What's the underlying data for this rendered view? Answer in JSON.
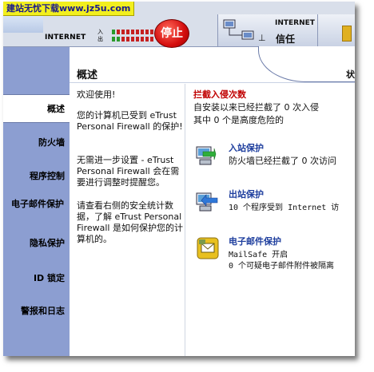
{
  "watermark": "建站无忧下载www.jz5u.com",
  "toolbar": {
    "internet_left": "INTERNET",
    "in_label": "入",
    "out_label": "出",
    "stop_label": "停止",
    "network_label": "INTERNET",
    "trust_label": "信任"
  },
  "sidebar": {
    "items": [
      {
        "label": "概述"
      },
      {
        "label": "防火墙"
      },
      {
        "label": "程序控制"
      },
      {
        "label": "电子邮件保护"
      },
      {
        "label": "隐私保护"
      },
      {
        "label": "ID 锁定"
      },
      {
        "label": "警报和日志"
      }
    ]
  },
  "content": {
    "title": "概述",
    "header_right": "状",
    "left": {
      "welcome": "欢迎使用!",
      "protected": "您的计算机已受到 eTrust Personal Firewall 的保护!",
      "setup": "无需进一步设置 - eTrust Personal Firewall 会在需要进行调整时提醒您。",
      "review": "请查看右侧的安全统计数据，了解 eTrust Personal Firewall 是如何保护您的计算机的。"
    },
    "intrusion": {
      "title": "拦截入侵次数",
      "line1": "自安装以来已经拦截了 0 次入侵",
      "line2": "其中 0 个是高度危险的"
    },
    "inbound": {
      "title": "入站保护",
      "line1": "防火墙已经拦截了 0 次访问"
    },
    "outbound": {
      "title": "出站保护",
      "line1": "10  个程序受到 Internet 访"
    },
    "email": {
      "title": "电子邮件保护",
      "line1": "MailSafe 开启",
      "line2": "0 个可疑电子邮件附件被隔离"
    }
  },
  "colors": {
    "sidebar": "#8c9ed1",
    "stop": "#d40d0d",
    "alert_title": "#c00000",
    "link_title": "#1f3f9e",
    "watermark_bg": "#f2ef1e"
  }
}
